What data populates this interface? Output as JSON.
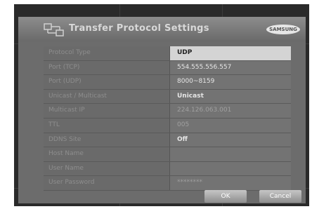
{
  "dialog": {
    "title": "Transfer Protocol Settings",
    "title_icon": "network-transfer-icon",
    "brand_logo": "SAMSUNG"
  },
  "settings": [
    {
      "label": "Protocol Type",
      "value": "UDP"
    },
    {
      "label": "Port (TCP)",
      "value": "554.555.556.557"
    },
    {
      "label": "Port (UDP)",
      "value": "8000~8159"
    },
    {
      "label": "Unicast / Multicast",
      "value": "Unicast"
    },
    {
      "label": "Multicast IP",
      "value": "224.126.063.001"
    },
    {
      "label": "TTL",
      "value": "005"
    },
    {
      "label": "DDNS Site",
      "value": "Off"
    },
    {
      "label": "Host Name",
      "value": ""
    },
    {
      "label": "User Name",
      "value": ""
    },
    {
      "label": "User Password",
      "value": "********"
    }
  ],
  "buttons": {
    "ok": "OK",
    "cancel": "Cancel"
  },
  "colors": {
    "panel": "#6c6c6c",
    "selected_value_bg": "#d4d4d4",
    "background": "#2a2a2a"
  }
}
